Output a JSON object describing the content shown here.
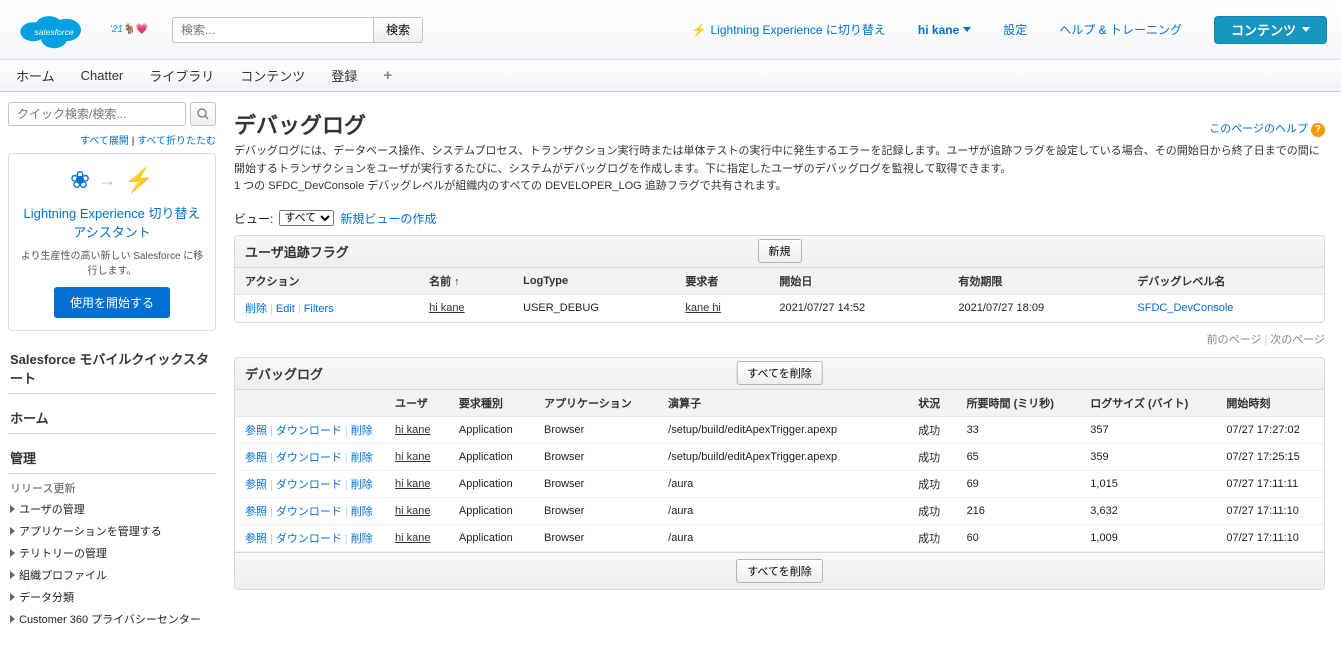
{
  "header": {
    "mascot_label": "'21",
    "search_placeholder": "検索...",
    "search_button": "検索",
    "lightning_link": "Lightning Experience に切り替え",
    "user": "hi kane",
    "settings": "設定",
    "help": "ヘルプ & トレーニング",
    "contents_button": "コンテンツ"
  },
  "nav": {
    "items": [
      "ホーム",
      "Chatter",
      "ライブラリ",
      "コンテンツ",
      "登録"
    ]
  },
  "sidebar": {
    "quick_placeholder": "クイック検索/検索...",
    "expand_all": "すべて展開",
    "collapse_all": "すべて折りたたむ",
    "promo_title": "Lightning Experience 切り替えアシスタント",
    "promo_text": "より生産性の高い新しい Salesforce に移行します。",
    "promo_button": "使用を開始する",
    "mobile_quick": "Salesforce モバイルクイックスタート",
    "home": "ホーム",
    "admin": "管理",
    "release": "リリース更新",
    "items": [
      "ユーザの管理",
      "アプリケーションを管理する",
      "テリトリーの管理",
      "組織プロファイル",
      "データ分類",
      "Customer 360 プライバシーセンター"
    ]
  },
  "page": {
    "title": "デバッグログ",
    "help": "このページのヘルプ",
    "desc1": "デバッグログには、データベース操作、システムプロセス、トランザクション実行時または単体テストの実行中に発生するエラーを記録します。ユーザが追跡フラグを設定している場合、その開始日から終了日までの間に開始するトランザクションをユーザが実行するたびに、システムがデバッグログを作成します。下に指定したユーザのデバッグログを監視して取得できます。",
    "desc2": "1 つの SFDC_DevConsole デバッグレベルが組織内のすべての DEVELOPER_LOG 追跡フラグで共有されます。",
    "view_label": "ビュー:",
    "view_option": "すべて",
    "new_view": "新規ビューの作成"
  },
  "trace": {
    "title": "ユーザ追跡フラグ",
    "new_button": "新規",
    "headers": {
      "action": "アクション",
      "name": "名前 ↑",
      "logtype": "LogType",
      "requester": "要求者",
      "start": "開始日",
      "expire": "有効期限",
      "level": "デバッグレベル名"
    },
    "actions": {
      "delete": "削除",
      "edit": "Edit",
      "filters": "Filters"
    },
    "rows": [
      {
        "name": "hi kane",
        "logtype": "USER_DEBUG",
        "requester": "kane hi",
        "start": "2021/07/27 14:52",
        "expire": "2021/07/27 18:09",
        "level": "SFDC_DevConsole"
      }
    ]
  },
  "pager": {
    "prev": "前のページ",
    "next": "次のページ"
  },
  "logs": {
    "title": "デバッグログ",
    "delete_all": "すべてを削除",
    "headers": {
      "user": "ユーザ",
      "reqtype": "要求種別",
      "app": "アプリケーション",
      "op": "演算子",
      "status": "状況",
      "time": "所要時間 (ミリ秒)",
      "size": "ログサイズ (バイト)",
      "start": "開始時刻"
    },
    "actions": {
      "view": "参照",
      "download": "ダウンロード",
      "delete": "削除"
    },
    "rows": [
      {
        "user": "hi kane",
        "reqtype": "Application",
        "app": "Browser",
        "op": "/setup/build/editApexTrigger.apexp",
        "status": "成功",
        "time": "33",
        "size": "357",
        "start": "07/27 17:27:02"
      },
      {
        "user": "hi kane",
        "reqtype": "Application",
        "app": "Browser",
        "op": "/setup/build/editApexTrigger.apexp",
        "status": "成功",
        "time": "65",
        "size": "359",
        "start": "07/27 17:25:15"
      },
      {
        "user": "hi kane",
        "reqtype": "Application",
        "app": "Browser",
        "op": "/aura",
        "status": "成功",
        "time": "69",
        "size": "1,015",
        "start": "07/27 17:11:11"
      },
      {
        "user": "hi kane",
        "reqtype": "Application",
        "app": "Browser",
        "op": "/aura",
        "status": "成功",
        "time": "216",
        "size": "3,632",
        "start": "07/27 17:11:10"
      },
      {
        "user": "hi kane",
        "reqtype": "Application",
        "app": "Browser",
        "op": "/aura",
        "status": "成功",
        "time": "60",
        "size": "1,009",
        "start": "07/27 17:11:10"
      }
    ]
  }
}
